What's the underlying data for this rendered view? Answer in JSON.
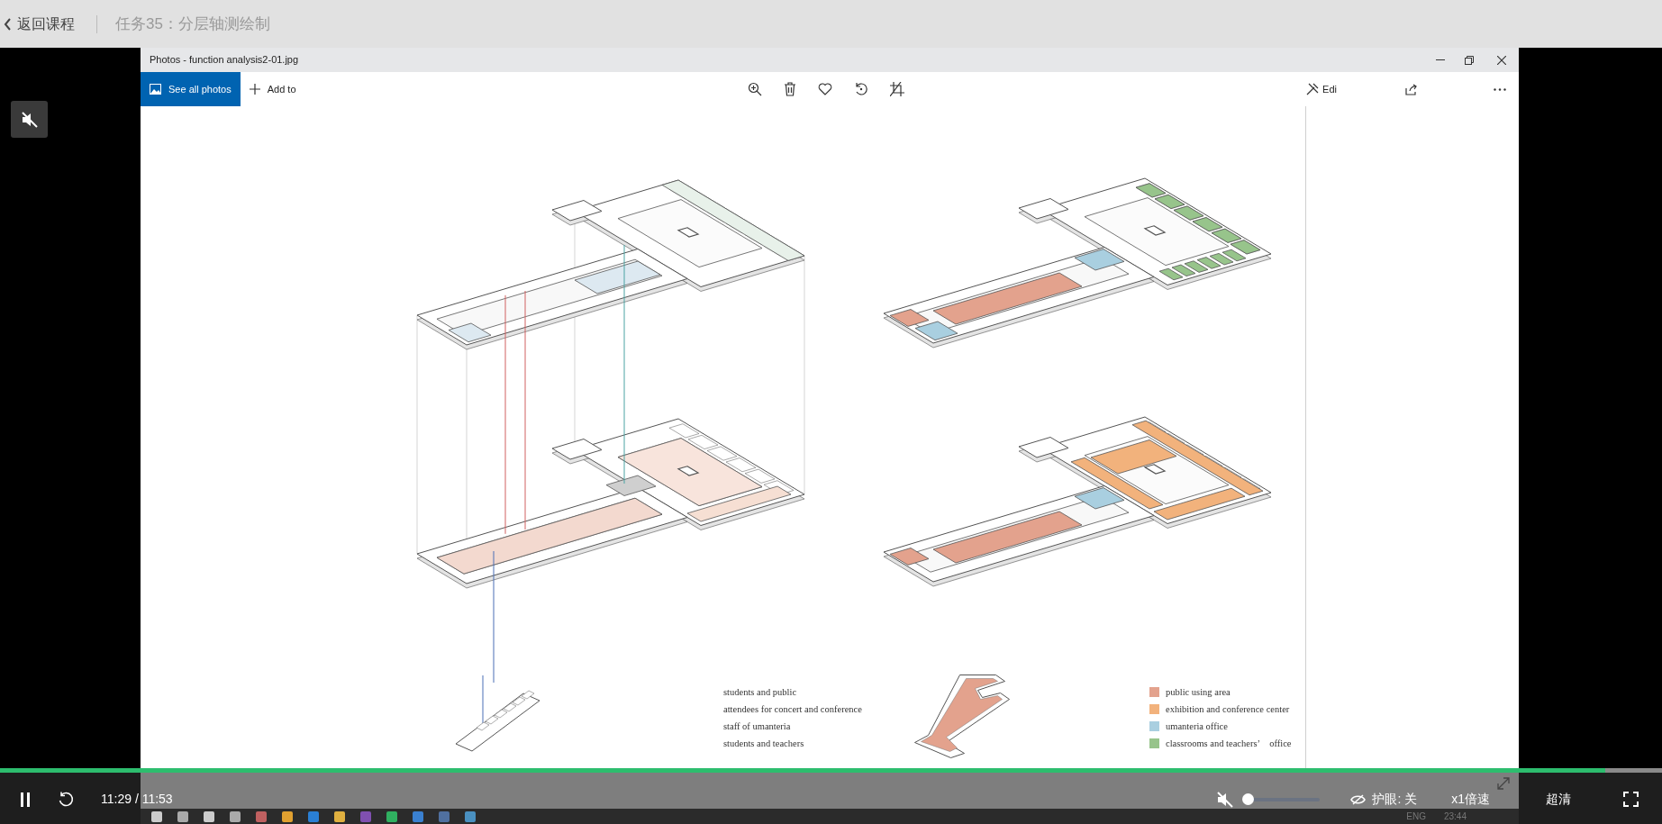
{
  "header": {
    "back_label": "返回课程",
    "title": "任务35：分层轴测绘制"
  },
  "video_mute_button": {
    "muted": true
  },
  "photos": {
    "title": "Photos - function analysis2-01.jpg",
    "nav": [
      {
        "label": "See all photos",
        "selected": true
      },
      {
        "label": "Add to",
        "selected": false
      }
    ],
    "edit_label": "Edi",
    "figure": {
      "people_legend": [
        "students and public",
        "attendees for concert and conference",
        "staff of umanteria",
        "students and teachers"
      ],
      "area_legend": [
        {
          "label": "public using area",
          "color": "#e3a28d"
        },
        {
          "label": "exhibition and conference center",
          "color": "#f2b27c"
        },
        {
          "label": "umanteria office",
          "color": "#a9cfe0"
        },
        {
          "label": "classrooms and teachers’　office",
          "color": "#97c48b"
        }
      ]
    }
  },
  "player": {
    "progress": {
      "level": 0.966
    },
    "playing": true,
    "time": "11:29 / 11:53",
    "muted": true,
    "volume": {
      "level": 0
    },
    "eye_care": "护眼: 关",
    "speed": "x1倍速",
    "quality": "超清"
  },
  "taskbar": {
    "language": "ENG",
    "clock": "23:44"
  }
}
